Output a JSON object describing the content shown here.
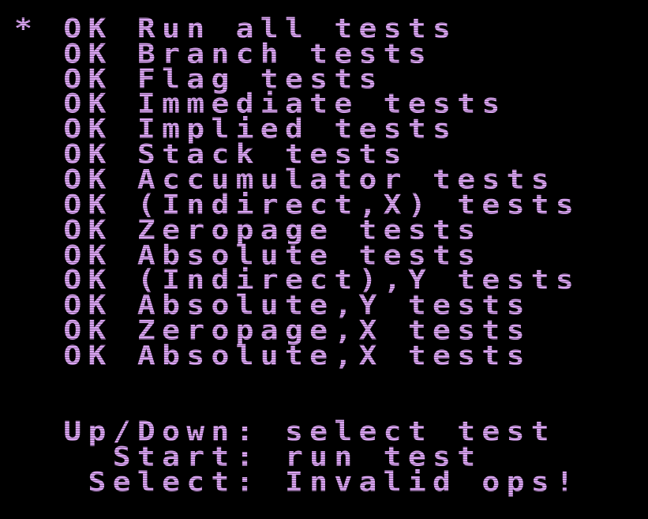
{
  "menu": {
    "cursor": "*",
    "items": [
      {
        "status": "OK",
        "label": "Run all tests"
      },
      {
        "status": "OK",
        "label": "Branch tests"
      },
      {
        "status": "OK",
        "label": "Flag tests"
      },
      {
        "status": "OK",
        "label": "Immediate tests"
      },
      {
        "status": "OK",
        "label": "Implied tests"
      },
      {
        "status": "OK",
        "label": "Stack tests"
      },
      {
        "status": "OK",
        "label": "Accumulator tests"
      },
      {
        "status": "OK",
        "label": "(Indirect,X) tests"
      },
      {
        "status": "OK",
        "label": "Zeropage tests"
      },
      {
        "status": "OK",
        "label": "Absolute tests"
      },
      {
        "status": "OK",
        "label": "(Indirect),Y tests"
      },
      {
        "status": "OK",
        "label": "Absolute,Y tests"
      },
      {
        "status": "OK",
        "label": "Zeropage,X tests"
      },
      {
        "status": "OK",
        "label": "Absolute,X tests"
      }
    ]
  },
  "help": {
    "updown": "Up/Down: select test",
    "start": "Start: run test",
    "select": "Select: Invalid ops!"
  },
  "colors": {
    "text": "#dca6f4",
    "background": "#000000"
  }
}
